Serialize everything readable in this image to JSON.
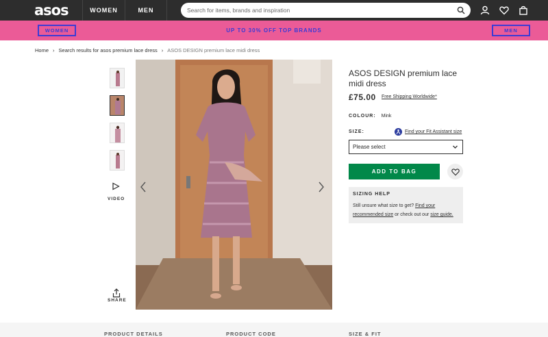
{
  "header": {
    "logo": "asos",
    "tabs": [
      "WOMEN",
      "MEN"
    ],
    "search_placeholder": "Search for items, brands and inspiration",
    "icons": [
      "search-icon",
      "account-icon",
      "heart-icon",
      "bag-icon"
    ]
  },
  "promo": {
    "left_button": "WOMEN",
    "text": "UP TO 30% OFF TOP BRANDS",
    "right_button": "MEN",
    "bg_color": "#eb5b97",
    "text_color": "#3a3bd6"
  },
  "breadcrumb": {
    "items": [
      "Home",
      "Search results for asos premium lace dress",
      "ASOS DESIGN premium lace midi dress"
    ],
    "separator": "›"
  },
  "gallery": {
    "video_label": "VIDEO",
    "share_label": "SHARE"
  },
  "product": {
    "title": "ASOS DESIGN premium lace midi dress",
    "price": "£75.00",
    "shipping": "Free Shipping Worldwide*",
    "colour_label": "COLOUR:",
    "colour_value": "Mink",
    "size_label": "SIZE:",
    "fit_link": "Find your Fit Assistant size",
    "size_placeholder": "Please select",
    "add_to_bag": "ADD TO BAG",
    "add_to_bag_color": "#018849",
    "sizing_help": {
      "title": "SIZING HELP",
      "line1_prefix": "Still unsure what size to get?",
      "line1_link": "Find your",
      "line2_link": "recommended size",
      "line2_mid": "or check out our",
      "line2_link2": "size guide."
    }
  },
  "bottom_tabs": [
    "PRODUCT DETAILS",
    "PRODUCT CODE",
    "SIZE & FIT"
  ]
}
